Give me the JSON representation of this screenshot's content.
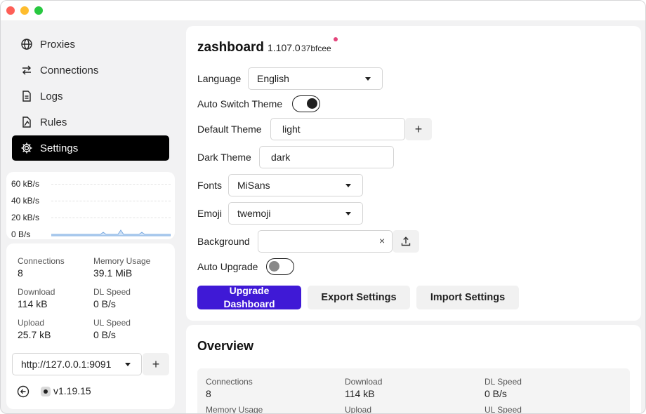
{
  "sidebar": {
    "items": [
      {
        "label": "Proxies",
        "icon": "globe-icon"
      },
      {
        "label": "Connections",
        "icon": "arrows-swap-icon"
      },
      {
        "label": "Logs",
        "icon": "document-icon"
      },
      {
        "label": "Rules",
        "icon": "rules-icon"
      },
      {
        "label": "Settings",
        "icon": "gear-icon",
        "active": true
      }
    ],
    "traffic_chart": {
      "labels": [
        "60 kB/s",
        "40 kB/s",
        "20 kB/s",
        "0 B/s"
      ]
    },
    "stats": {
      "connections_label": "Connections",
      "connections_value": "8",
      "memory_label": "Memory Usage",
      "memory_value": "39.1 MiB",
      "download_label": "Download",
      "download_value": "114 kB",
      "dl_speed_label": "DL Speed",
      "dl_speed_value": "0 B/s",
      "upload_label": "Upload",
      "upload_value": "25.7 kB",
      "ul_speed_label": "UL Speed",
      "ul_speed_value": "0 B/s"
    },
    "backend": {
      "value": "http://127.0.0.1:9091",
      "add": "+"
    },
    "core_version": "v1.19.15"
  },
  "settings": {
    "app_name": "zashboard",
    "version": "1.107.0",
    "hash": "37bfcee",
    "language_label": "Language",
    "language_value": "English",
    "auto_switch_label": "Auto Switch Theme",
    "default_theme_label": "Default Theme",
    "default_theme_value": "light",
    "add": "+",
    "dark_theme_label": "Dark Theme",
    "dark_theme_value": "dark",
    "fonts_label": "Fonts",
    "fonts_value": "MiSans",
    "emoji_label": "Emoji",
    "emoji_value": "twemoji",
    "background_label": "Background",
    "clear": "×",
    "auto_upgrade_label": "Auto Upgrade",
    "upgrade_button_line1": "Upgrade",
    "upgrade_button_line2": "Dashboard",
    "export_button": "Export Settings",
    "import_button": "Import Settings",
    "toggles": {
      "auto_switch_theme": true,
      "auto_upgrade": false
    }
  },
  "overview": {
    "title": "Overview",
    "connections_label": "Connections",
    "connections_value": "8",
    "download_label": "Download",
    "download_value": "114 kB",
    "dl_speed_label": "DL Speed",
    "dl_speed_value": "0 B/s",
    "memory_label": "Memory Usage",
    "upload_label": "Upload",
    "ul_speed_label": "UL Speed"
  },
  "colors": {
    "accent": "#3f19d6",
    "active_nav": "#000000",
    "notification_dot": "#e4447b"
  }
}
